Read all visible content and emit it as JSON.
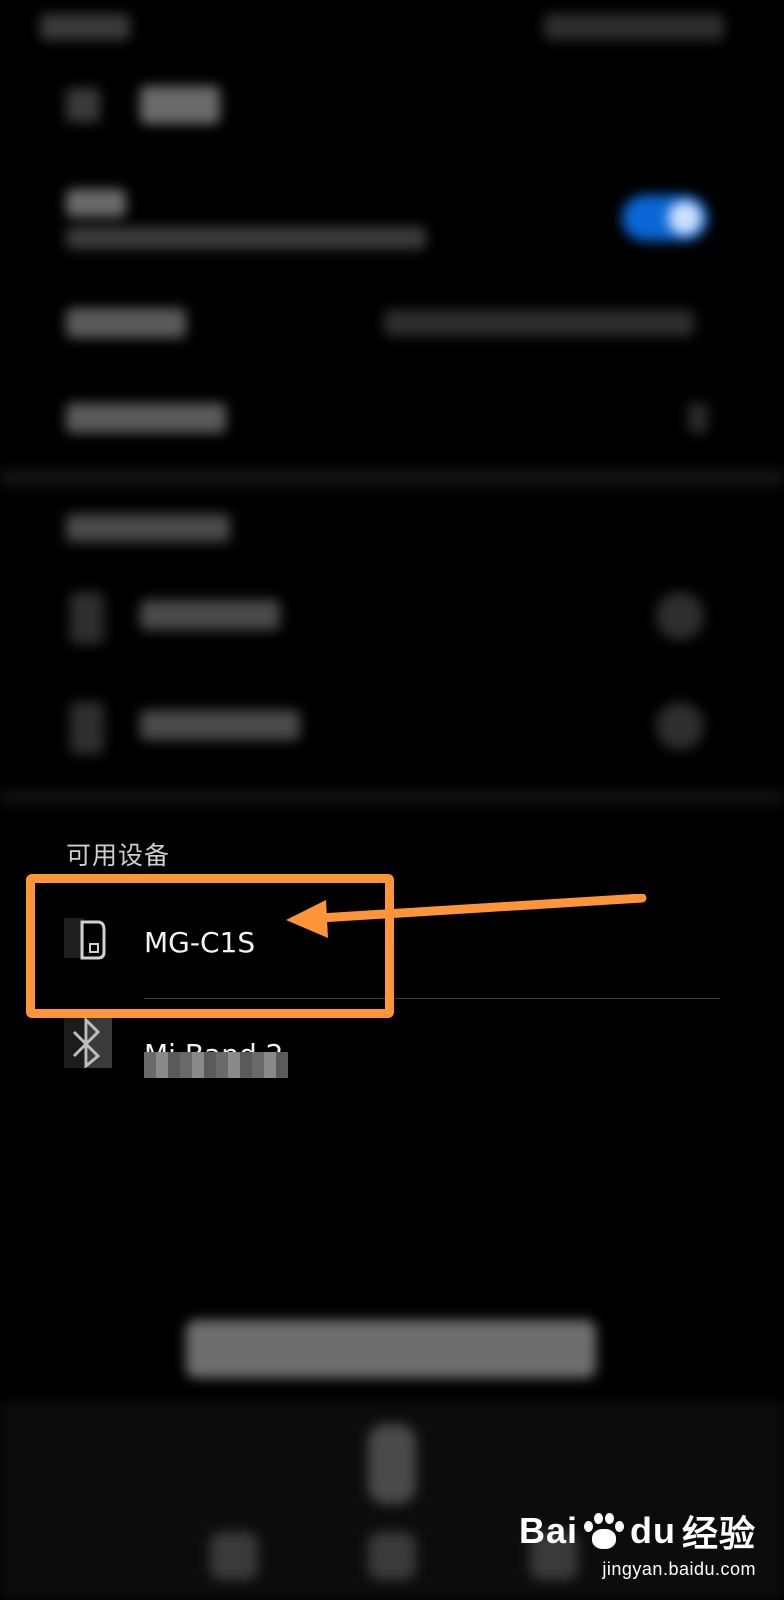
{
  "available_section": {
    "header": "可用设备",
    "devices": [
      {
        "name": "MG-C1S",
        "icon": "printer-icon"
      },
      {
        "name": "Mi Band 2",
        "icon": "bluetooth-icon"
      }
    ]
  },
  "annotation": {
    "highlight_color": "#ff9438"
  },
  "toggle": {
    "state": "on",
    "color": "#0a66d6"
  },
  "watermark": {
    "brand_left": "Bai",
    "brand_right": "du",
    "brand_cn": "经验",
    "site": "jingyan.baidu.com"
  }
}
